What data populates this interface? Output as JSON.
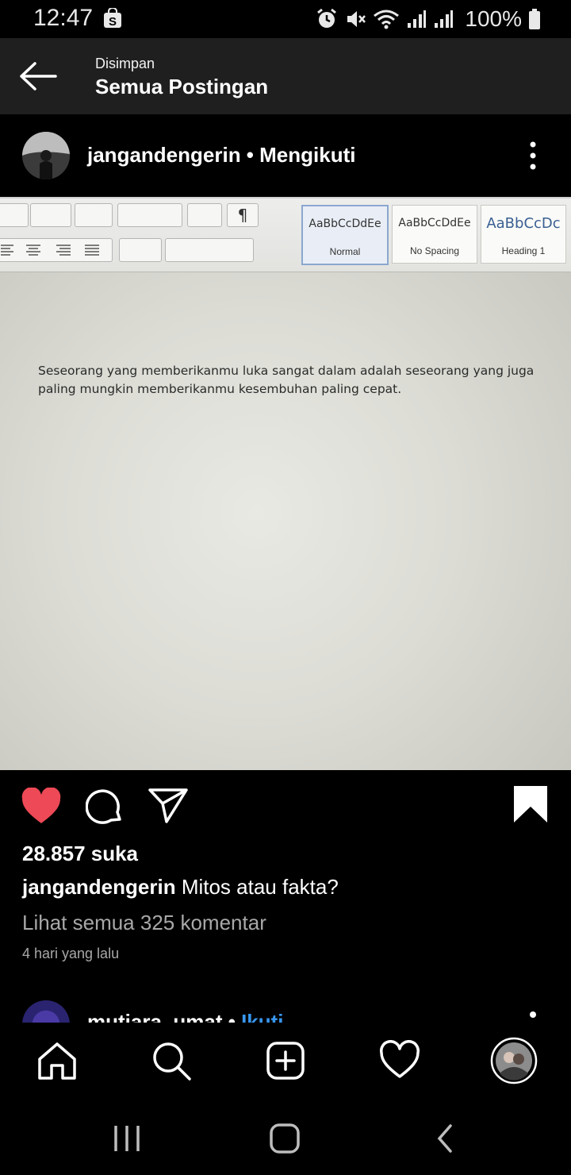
{
  "status_bar": {
    "time": "12:47",
    "battery_text": "100%"
  },
  "header": {
    "subtitle": "Disimpan",
    "title": "Semua Postingan"
  },
  "post": {
    "author_line": "jangandengerin • Mengikuti",
    "word_ribbon": {
      "styles": [
        {
          "sample": "AaBbCcDdEe",
          "name": "Normal"
        },
        {
          "sample": "AaBbCcDdEe",
          "name": "No Spacing"
        },
        {
          "sample": "AaBbCcDc",
          "name": "Heading 1"
        }
      ]
    },
    "document_text": "Seseorang yang memberikanmu luka sangat dalam adalah seseorang yang juga paling mungkin memberikanmu kesembuhan paling cepat.",
    "likes": "28.857 suka",
    "caption_user": "jangandengerin",
    "caption_text": "Mitos atau fakta?",
    "comments_link": "Lihat semua 325 komentar",
    "time_ago": "4 hari yang lalu"
  },
  "next_post": {
    "username": "mutiara_umat • ",
    "follow": "Ikuti"
  },
  "icons": {
    "like": "heart-filled-icon",
    "comment": "comment-icon",
    "share": "send-icon",
    "save": "bookmark-filled-icon",
    "home": "home-icon",
    "search": "search-icon",
    "create": "add-post-icon",
    "activity": "heart-outline-icon",
    "profile": "profile-avatar"
  },
  "colors": {
    "like_red": "#ED4956",
    "follow_blue": "#3897F0",
    "appbar_bg": "#1F1F1F"
  }
}
